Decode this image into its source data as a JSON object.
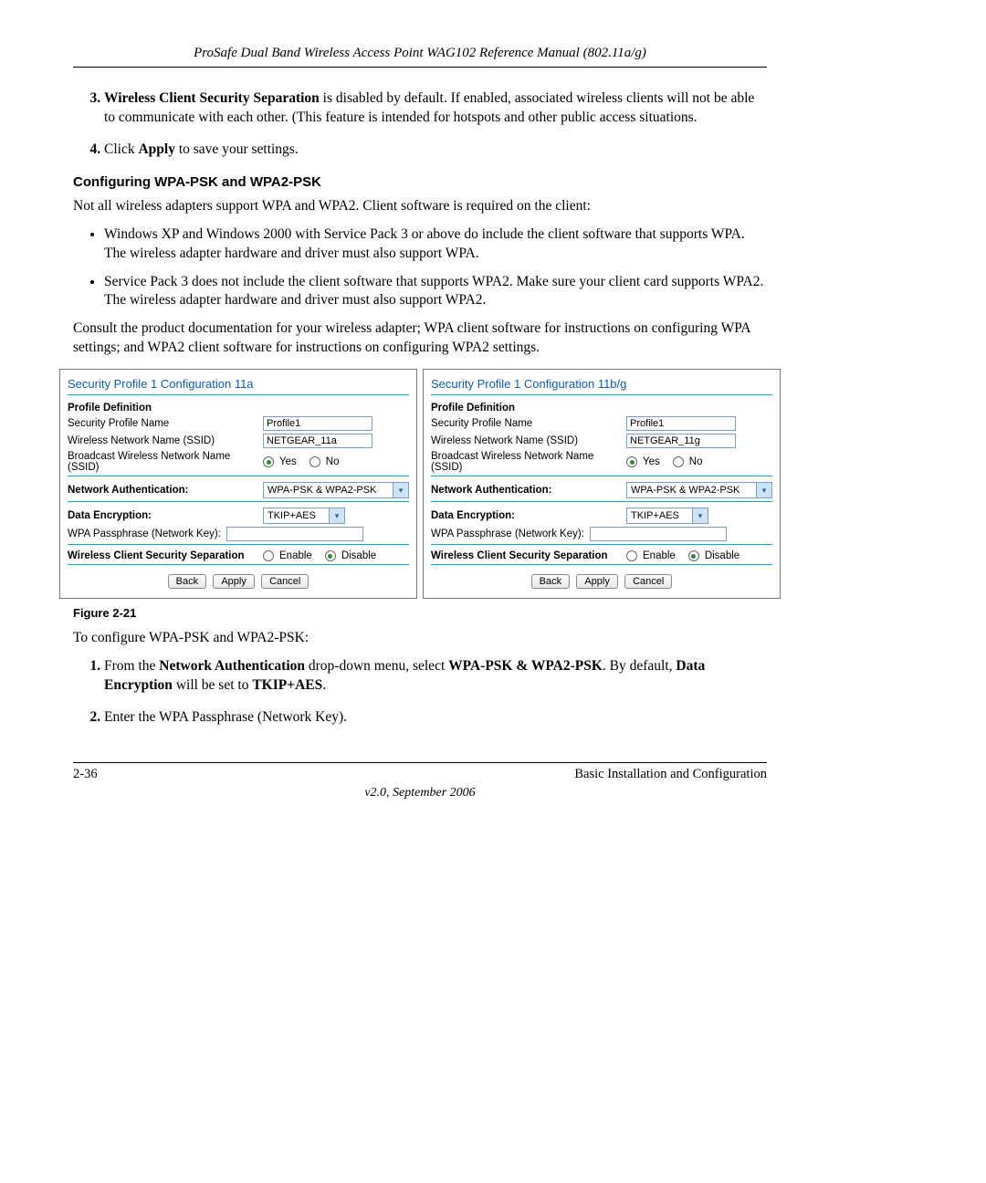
{
  "header": {
    "title": "ProSafe Dual Band Wireless Access Point WAG102 Reference Manual (802.11a/g)"
  },
  "list3": {
    "bold": "Wireless Client Security Separation",
    "rest": " is disabled by default. If enabled, associated wireless clients will not be able to communicate with each other. (This feature is intended for hotspots and other public access situations."
  },
  "list4": {
    "pre": "Click ",
    "bold": "Apply",
    "post": " to save your settings."
  },
  "section_heading": "Configuring WPA-PSK and WPA2-PSK",
  "intro": "Not all wireless adapters support WPA and WPA2. Client software is required on the client:",
  "bullets": [
    "Windows XP and Windows 2000 with Service Pack 3 or above do include the client software that supports WPA. The wireless adapter hardware and driver must also support WPA.",
    "Service Pack 3 does not include the client software that supports WPA2. Make sure your client card supports WPA2. The wireless adapter hardware and driver must also support WPA2."
  ],
  "consult": "Consult the product documentation for your wireless adapter; WPA client software for instructions on configuring WPA settings; and WPA2 client software for instructions on configuring WPA2 settings.",
  "panel_labels": {
    "profile_def": "Profile Definition",
    "sec_profile_name": "Security Profile Name",
    "wnn": "Wireless Network Name (SSID)",
    "broadcast": "Broadcast Wireless Network Name (SSID)",
    "yes": "Yes",
    "no": "No",
    "net_auth": "Network Authentication:",
    "data_enc": "Data Encryption:",
    "passphrase": "WPA Passphrase (Network Key):",
    "separation": "Wireless Client Security Separation",
    "enable": "Enable",
    "disable": "Disable",
    "back": "Back",
    "apply": "Apply",
    "cancel": "Cancel",
    "auth_val": "WPA-PSK & WPA2-PSK",
    "enc_val": "TKIP+AES"
  },
  "panelA": {
    "title": "Security Profile 1 Configuration 11a",
    "profile_name": "Profile1",
    "ssid": "NETGEAR_11a"
  },
  "panelB": {
    "title": "Security Profile 1 Configuration 11b/g",
    "profile_name": "Profile1",
    "ssid": "NETGEAR_11g"
  },
  "figure_caption": "Figure 2-21",
  "to_configure": "To configure WPA-PSK and WPA2-PSK:",
  "step1": {
    "pre": "From the ",
    "b1": "Network Authentication",
    "mid1": " drop-down menu, select ",
    "b2": "WPA-PSK & WPA2-PSK",
    "mid2": ". By default, ",
    "b3": "Data Encryption",
    "mid3": " will be set to ",
    "b4": "TKIP+AES",
    "post": "."
  },
  "step2": "Enter the WPA Passphrase (Network Key).",
  "footer": {
    "page": "2-36",
    "section": "Basic Installation and Configuration",
    "version": "v2.0, September 2006"
  }
}
